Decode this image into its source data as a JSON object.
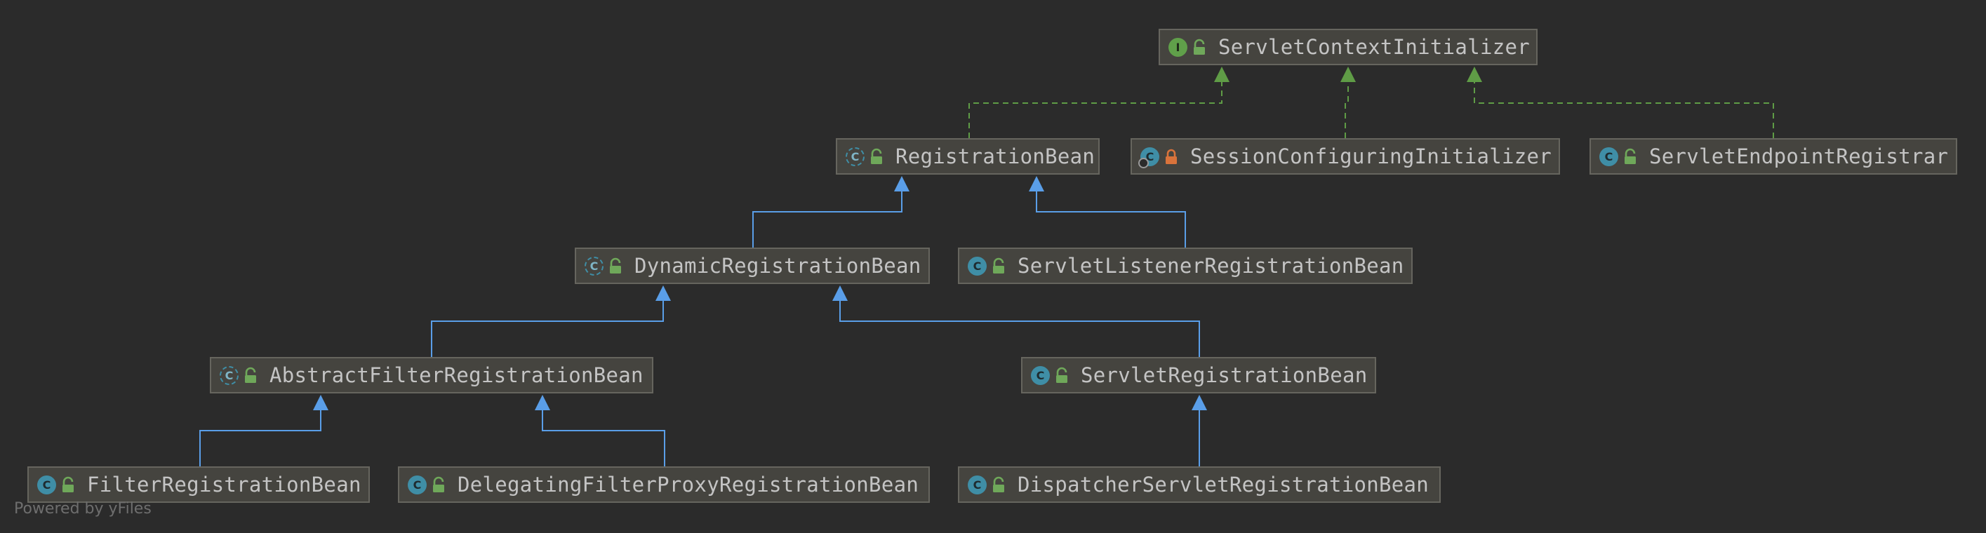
{
  "nodes": [
    {
      "id": "sci",
      "label": "ServletContextInitializer",
      "kind": "interface",
      "access": "public"
    },
    {
      "id": "rb",
      "label": "RegistrationBean",
      "kind": "abstract",
      "access": "public"
    },
    {
      "id": "sesscfg",
      "label": "SessionConfiguringInitializer",
      "kind": "class-inner",
      "access": "private"
    },
    {
      "id": "ser",
      "label": "ServletEndpointRegistrar",
      "kind": "class",
      "access": "public"
    },
    {
      "id": "drb",
      "label": "DynamicRegistrationBean",
      "kind": "abstract",
      "access": "public"
    },
    {
      "id": "slrb",
      "label": "ServletListenerRegistrationBean",
      "kind": "class",
      "access": "public"
    },
    {
      "id": "afrb",
      "label": "AbstractFilterRegistrationBean",
      "kind": "abstract",
      "access": "public"
    },
    {
      "id": "srb",
      "label": "ServletRegistrationBean",
      "kind": "class",
      "access": "public"
    },
    {
      "id": "frb",
      "label": "FilterRegistrationBean",
      "kind": "class",
      "access": "public"
    },
    {
      "id": "dfprb",
      "label": "DelegatingFilterProxyRegistrationBean",
      "kind": "class",
      "access": "public"
    },
    {
      "id": "dsrb",
      "label": "DispatcherServletRegistrationBean",
      "kind": "class",
      "access": "public"
    }
  ],
  "edges": [
    {
      "from": "rb",
      "to": "sci",
      "type": "implements"
    },
    {
      "from": "sesscfg",
      "to": "sci",
      "type": "implements"
    },
    {
      "from": "ser",
      "to": "sci",
      "type": "implements"
    },
    {
      "from": "drb",
      "to": "rb",
      "type": "extends"
    },
    {
      "from": "slrb",
      "to": "rb",
      "type": "extends"
    },
    {
      "from": "afrb",
      "to": "drb",
      "type": "extends"
    },
    {
      "from": "srb",
      "to": "drb",
      "type": "extends"
    },
    {
      "from": "frb",
      "to": "afrb",
      "type": "extends"
    },
    {
      "from": "dfprb",
      "to": "afrb",
      "type": "extends"
    },
    {
      "from": "dsrb",
      "to": "srb",
      "type": "extends"
    }
  ],
  "colors": {
    "implements": "#5f9c46",
    "extends": "#5a9ee8",
    "public_lock": "#6fa85a",
    "private_lock": "#d9733b"
  },
  "watermark": "Powered by yFiles"
}
